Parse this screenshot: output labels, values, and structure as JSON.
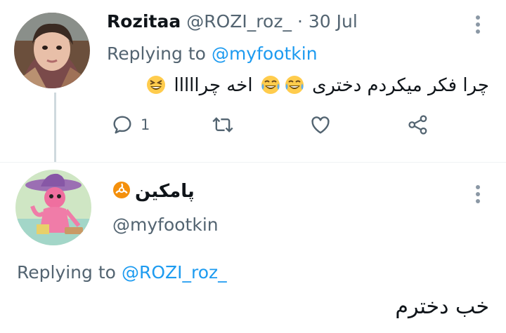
{
  "tweet1": {
    "display_name": "Rozitaa",
    "handle": "@ROZI_roz_",
    "separator": "·",
    "date": "30 Jul",
    "replying_prefix": "Replying to",
    "replying_handle": "@myfootkin",
    "text": "چرا فکر میکردم دختری",
    "text2": "اخه چرااااا",
    "reply_count": "1"
  },
  "tweet2": {
    "display_name": "پامکین",
    "handle": "@myfootkin",
    "replying_prefix": "Replying to",
    "replying_handle": "@ROZI_roz_",
    "text": "خب دخترم"
  },
  "colors": {
    "accent": "#1d9bf0",
    "muted": "#536471",
    "text": "#0f1419"
  },
  "icons": [
    "reply-icon",
    "retweet-icon",
    "like-icon",
    "share-icon",
    "more-icon",
    "biohazard-icon",
    "laughing-emoji",
    "tears-of-joy-emoji"
  ]
}
